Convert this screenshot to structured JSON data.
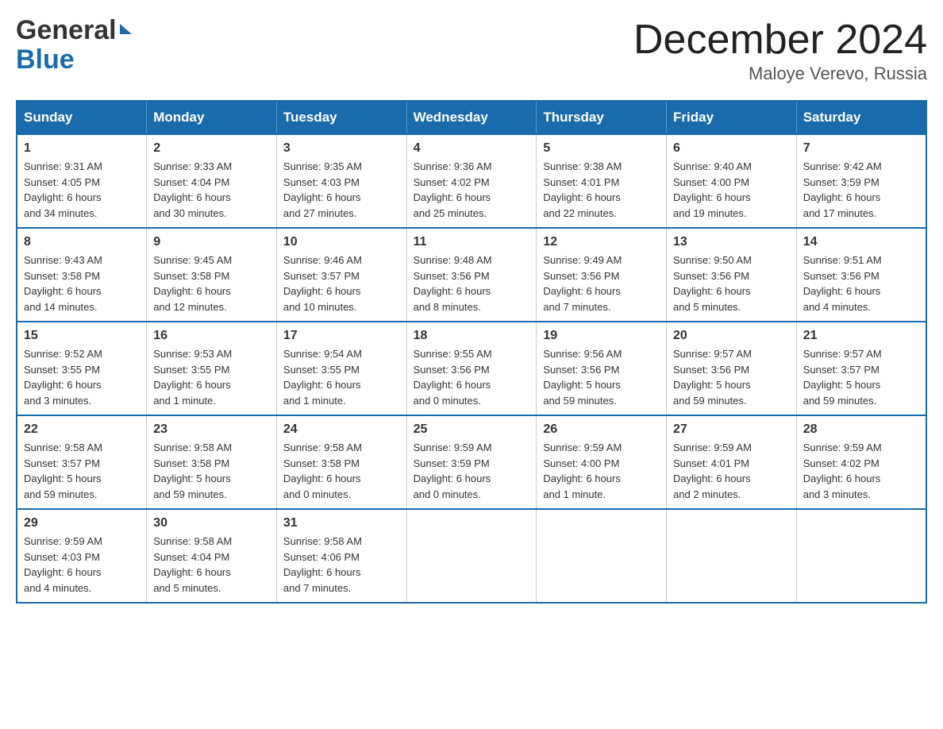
{
  "header": {
    "logo": {
      "line1": "General",
      "line2": "Blue"
    },
    "title": "December 2024",
    "location": "Maloye Verevo, Russia"
  },
  "calendar": {
    "days_of_week": [
      "Sunday",
      "Monday",
      "Tuesday",
      "Wednesday",
      "Thursday",
      "Friday",
      "Saturday"
    ],
    "weeks": [
      [
        {
          "day": 1,
          "sunrise": "9:31 AM",
          "sunset": "4:05 PM",
          "daylight": "6 hours and 34 minutes."
        },
        {
          "day": 2,
          "sunrise": "9:33 AM",
          "sunset": "4:04 PM",
          "daylight": "6 hours and 30 minutes."
        },
        {
          "day": 3,
          "sunrise": "9:35 AM",
          "sunset": "4:03 PM",
          "daylight": "6 hours and 27 minutes."
        },
        {
          "day": 4,
          "sunrise": "9:36 AM",
          "sunset": "4:02 PM",
          "daylight": "6 hours and 25 minutes."
        },
        {
          "day": 5,
          "sunrise": "9:38 AM",
          "sunset": "4:01 PM",
          "daylight": "6 hours and 22 minutes."
        },
        {
          "day": 6,
          "sunrise": "9:40 AM",
          "sunset": "4:00 PM",
          "daylight": "6 hours and 19 minutes."
        },
        {
          "day": 7,
          "sunrise": "9:42 AM",
          "sunset": "3:59 PM",
          "daylight": "6 hours and 17 minutes."
        }
      ],
      [
        {
          "day": 8,
          "sunrise": "9:43 AM",
          "sunset": "3:58 PM",
          "daylight": "6 hours and 14 minutes."
        },
        {
          "day": 9,
          "sunrise": "9:45 AM",
          "sunset": "3:58 PM",
          "daylight": "6 hours and 12 minutes."
        },
        {
          "day": 10,
          "sunrise": "9:46 AM",
          "sunset": "3:57 PM",
          "daylight": "6 hours and 10 minutes."
        },
        {
          "day": 11,
          "sunrise": "9:48 AM",
          "sunset": "3:56 PM",
          "daylight": "6 hours and 8 minutes."
        },
        {
          "day": 12,
          "sunrise": "9:49 AM",
          "sunset": "3:56 PM",
          "daylight": "6 hours and 7 minutes."
        },
        {
          "day": 13,
          "sunrise": "9:50 AM",
          "sunset": "3:56 PM",
          "daylight": "6 hours and 5 minutes."
        },
        {
          "day": 14,
          "sunrise": "9:51 AM",
          "sunset": "3:56 PM",
          "daylight": "6 hours and 4 minutes."
        }
      ],
      [
        {
          "day": 15,
          "sunrise": "9:52 AM",
          "sunset": "3:55 PM",
          "daylight": "6 hours and 3 minutes."
        },
        {
          "day": 16,
          "sunrise": "9:53 AM",
          "sunset": "3:55 PM",
          "daylight": "6 hours and 1 minute."
        },
        {
          "day": 17,
          "sunrise": "9:54 AM",
          "sunset": "3:55 PM",
          "daylight": "6 hours and 1 minute."
        },
        {
          "day": 18,
          "sunrise": "9:55 AM",
          "sunset": "3:56 PM",
          "daylight": "6 hours and 0 minutes."
        },
        {
          "day": 19,
          "sunrise": "9:56 AM",
          "sunset": "3:56 PM",
          "daylight": "5 hours and 59 minutes."
        },
        {
          "day": 20,
          "sunrise": "9:57 AM",
          "sunset": "3:56 PM",
          "daylight": "5 hours and 59 minutes."
        },
        {
          "day": 21,
          "sunrise": "9:57 AM",
          "sunset": "3:57 PM",
          "daylight": "5 hours and 59 minutes."
        }
      ],
      [
        {
          "day": 22,
          "sunrise": "9:58 AM",
          "sunset": "3:57 PM",
          "daylight": "5 hours and 59 minutes."
        },
        {
          "day": 23,
          "sunrise": "9:58 AM",
          "sunset": "3:58 PM",
          "daylight": "5 hours and 59 minutes."
        },
        {
          "day": 24,
          "sunrise": "9:58 AM",
          "sunset": "3:58 PM",
          "daylight": "6 hours and 0 minutes."
        },
        {
          "day": 25,
          "sunrise": "9:59 AM",
          "sunset": "3:59 PM",
          "daylight": "6 hours and 0 minutes."
        },
        {
          "day": 26,
          "sunrise": "9:59 AM",
          "sunset": "4:00 PM",
          "daylight": "6 hours and 1 minute."
        },
        {
          "day": 27,
          "sunrise": "9:59 AM",
          "sunset": "4:01 PM",
          "daylight": "6 hours and 2 minutes."
        },
        {
          "day": 28,
          "sunrise": "9:59 AM",
          "sunset": "4:02 PM",
          "daylight": "6 hours and 3 minutes."
        }
      ],
      [
        {
          "day": 29,
          "sunrise": "9:59 AM",
          "sunset": "4:03 PM",
          "daylight": "6 hours and 4 minutes."
        },
        {
          "day": 30,
          "sunrise": "9:58 AM",
          "sunset": "4:04 PM",
          "daylight": "6 hours and 5 minutes."
        },
        {
          "day": 31,
          "sunrise": "9:58 AM",
          "sunset": "4:06 PM",
          "daylight": "6 hours and 7 minutes."
        },
        null,
        null,
        null,
        null
      ]
    ]
  }
}
